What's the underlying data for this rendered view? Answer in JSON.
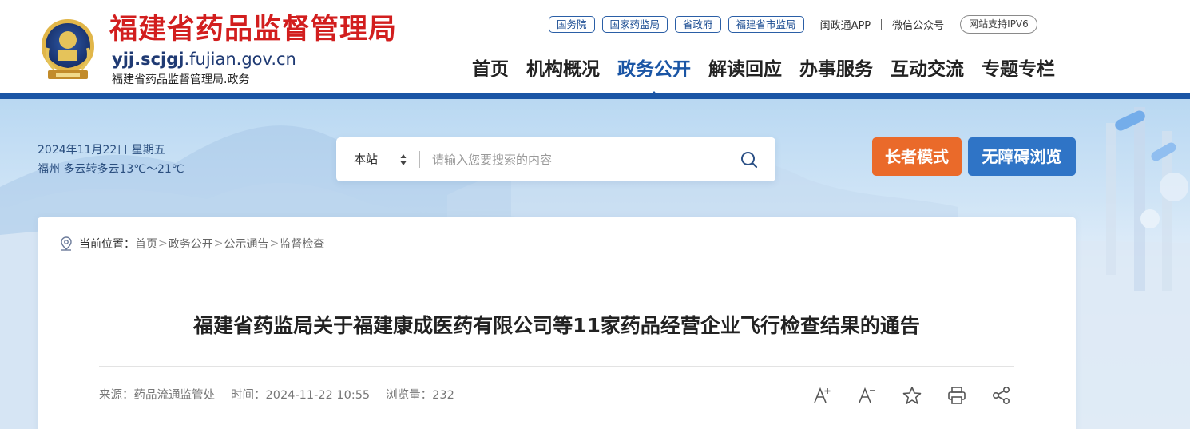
{
  "header": {
    "title": "福建省药品监督管理局",
    "domain_bold": "yjj.scjgj",
    "domain_rest": ".fujian.gov.cn",
    "subtitle": "福建省药品监督管理局.政务",
    "emblem_icon": "national-emblem-icon"
  },
  "toplinks": {
    "boxed": [
      "国务院",
      "国家药监局",
      "省政府",
      "福建省市监局"
    ],
    "app": "闽政通APP",
    "wechat": "微信公众号",
    "ipv6": "网站支持IPV6"
  },
  "nav": {
    "items": [
      "首页",
      "机构概况",
      "政务公开",
      "解读回应",
      "办事服务",
      "互动交流",
      "专题专栏"
    ],
    "active_index": 2
  },
  "info": {
    "date": "2024年11月22日 星期五",
    "weather": "福州 多云转多云13℃～21℃"
  },
  "search": {
    "scope": "本站",
    "placeholder": "请输入您要搜索的内容"
  },
  "buttons": {
    "elder_mode": "长者模式",
    "accessible": "无障碍浏览"
  },
  "breadcrumb": {
    "label": "当前位置：",
    "items": [
      "首页",
      "政务公开",
      "公示通告",
      "监督检查"
    ],
    "separator": ">"
  },
  "article": {
    "title": "福建省药监局关于福建康成医药有限公司等11家药品经营企业飞行检查结果的通告",
    "source": "来源：药品流通监管处",
    "time": "时间：2024-11-22 10:55",
    "views": "浏览量：232"
  },
  "tools": [
    "font-increase-icon",
    "font-decrease-icon",
    "favorite-star-icon",
    "print-icon",
    "share-icon"
  ],
  "colors": {
    "brand_red": "#d21e1e",
    "brand_blue": "#1a55a5",
    "elder_orange": "#ea6a2a",
    "access_blue": "#2f74c6"
  }
}
